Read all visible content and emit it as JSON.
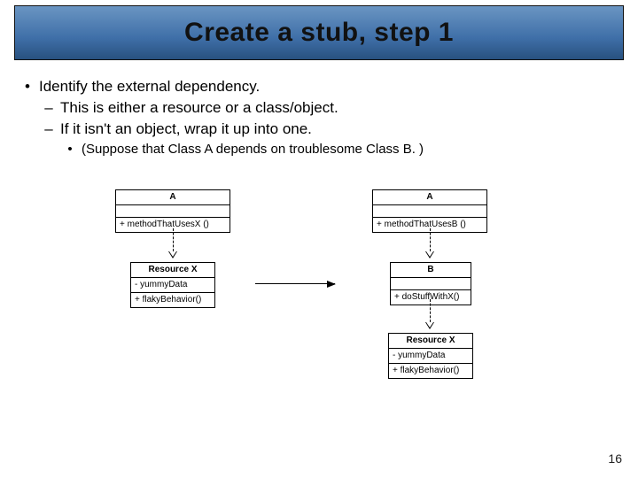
{
  "title": "Create a stub, step 1",
  "bullets": {
    "b1": "Identify the external dependency.",
    "b2a": "This is either a resource or a class/object.",
    "b2b": "If it isn't an object, wrap it up into one.",
    "b3": "(Suppose that Class A depends on troublesome Class B. )"
  },
  "uml": {
    "left_A_name": "A",
    "left_A_method": "+ methodThatUsesX ()",
    "left_X_name": "Resource X",
    "left_X_field": "- yummyData",
    "left_X_method": "+ flakyBehavior()",
    "right_A_name": "A",
    "right_A_method": "+ methodThatUsesB ()",
    "right_B_name": "B",
    "right_B_method": "+ doStuffWithX()",
    "right_X_name": "Resource X",
    "right_X_field": "- yummyData",
    "right_X_method": "+ flakyBehavior()"
  },
  "page": "16"
}
